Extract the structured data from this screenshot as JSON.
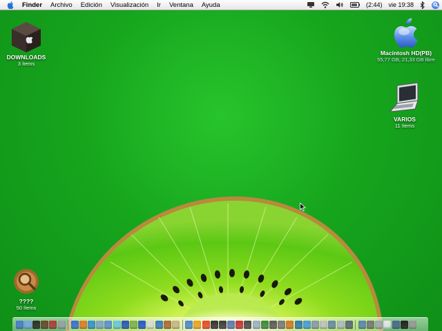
{
  "menubar": {
    "app_name": "Finder",
    "items": [
      "Archivo",
      "Edición",
      "Visualización",
      "Ir",
      "Ventana",
      "Ayuda"
    ],
    "battery_label": "(2:44)",
    "clock_label": "vie 19:38"
  },
  "desktop_icons": {
    "downloads": {
      "name": "DOWNLOADS",
      "info": "3 ítems"
    },
    "macintosh_hd": {
      "name": "Macintosh HD(PB)",
      "info": "55,77 GB, 21,33 GB libre"
    },
    "varios": {
      "name": "VARIOS",
      "info": "11 ítems"
    },
    "unknown_folder": {
      "name": "????",
      "info": "50 ítems"
    }
  },
  "dock": {
    "colors": [
      "#4a7fd0",
      "#7aa6e0",
      "#2d2d2d",
      "#6b4a2b",
      "#b23b3b",
      "#9aa0a8",
      "#3b6fd6",
      "#e07a2b",
      "#3a8fd8",
      "#7fa5c9",
      "#5c8fd9",
      "#66c8e0",
      "#2b58b8",
      "#7cb24a",
      "#2459c9",
      "#d9d9d9",
      "#3a7ac0",
      "#a86b3a",
      "#c8b48a",
      "#4b8ad0",
      "#f0a020",
      "#e84a2a",
      "#333333",
      "#3a3a3a",
      "#5a7ab0",
      "#c83232",
      "#4a4a4a",
      "#9ab0c8",
      "#3a8a3a",
      "#5a5a5a",
      "#7a7a7a",
      "#d07a2a",
      "#2f7ab0",
      "#4a9ad8",
      "#8899aa",
      "#c0c0c0",
      "#6a8aaa",
      "#b0b8c0",
      "#5a6a7a",
      "#5b85b0",
      "#777777",
      "#a0a8b0",
      "#e8e8e8",
      "#4a6a8a",
      "#222222",
      "#9a9a9a"
    ],
    "separators_after": [
      5,
      18,
      38
    ]
  }
}
